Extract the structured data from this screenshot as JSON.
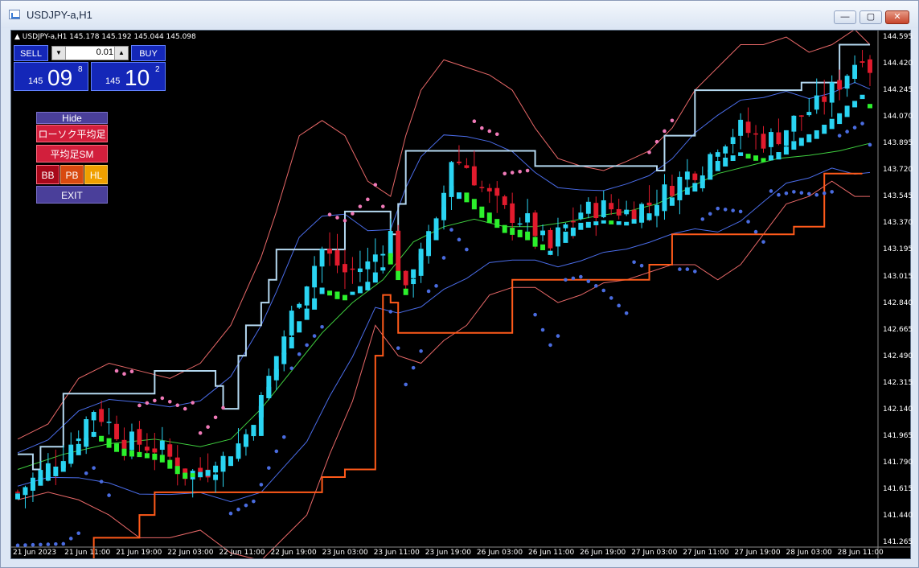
{
  "window": {
    "title": "USDJPY-a,H1",
    "minimize_label": "—",
    "maximize_label": "▢",
    "close_label": "✕"
  },
  "header": {
    "symbol_line": "▲ USDJPY-a,H1  145.178 145.192 145.044 145.098"
  },
  "trade_panel": {
    "sell_label": "SELL",
    "buy_label": "BUY",
    "lot_value": "0.01",
    "lot_down": "▼",
    "lot_up": "▲",
    "sell_prefix": "145",
    "sell_big": "09",
    "sell_sup": "8",
    "buy_prefix": "145",
    "buy_big": "10",
    "buy_sup": "2"
  },
  "indicator_panel": {
    "hide_label": "Hide",
    "btn1_label": "ローソク平均足2",
    "btn2_label": "平均足SM",
    "bb_label": "BB",
    "pb_label": "PB",
    "hl_label": "HL",
    "exit_label": "EXIT"
  },
  "colors": {
    "bull": "#2ad4f2",
    "bear": "#e11b2d",
    "green": "#2cf02c",
    "bb_outer": "#e86868",
    "bb_inner": "#4a6ce8",
    "ma": "#3fcf3f",
    "channel_top": "#b4d8f0",
    "channel_bottom": "#ff5a1a",
    "psar_up": "#4a6ce0",
    "psar_down": "#f07ab8"
  },
  "chart_data": {
    "type": "candlestick",
    "symbol": "USDJPY-a",
    "timeframe": "H1",
    "ohlc_header": {
      "open": 145.178,
      "high": 145.192,
      "low": 145.044,
      "close": 145.098
    },
    "y_ticks": [
      "144.595",
      "144.420",
      "144.245",
      "144.070",
      "143.895",
      "143.720",
      "143.545",
      "143.370",
      "143.195",
      "143.015",
      "142.840",
      "142.665",
      "142.490",
      "142.315",
      "142.140",
      "141.965",
      "141.790",
      "141.615",
      "141.440",
      "141.265"
    ],
    "x_ticks": [
      "21 Jun 2023",
      "21 Jun 11:00",
      "21 Jun 19:00",
      "22 Jun 03:00",
      "22 Jun 11:00",
      "22 Jun 19:00",
      "23 Jun 03:00",
      "23 Jun 11:00",
      "23 Jun 19:00",
      "26 Jun 03:00",
      "26 Jun 11:00",
      "26 Jun 19:00",
      "27 Jun 03:00",
      "27 Jun 11:00",
      "27 Jun 19:00",
      "28 Jun 03:00",
      "28 Jun 11:00"
    ],
    "ylim": [
      141.2,
      144.7
    ],
    "close_path": [
      [
        0,
        141.6
      ],
      [
        6,
        141.85
      ],
      [
        10,
        142.15
      ],
      [
        14,
        141.95
      ],
      [
        19,
        141.88
      ],
      [
        22,
        141.72
      ],
      [
        25,
        141.75
      ],
      [
        28,
        141.85
      ],
      [
        31,
        142.05
      ],
      [
        34,
        142.5
      ],
      [
        37,
        142.9
      ],
      [
        40,
        143.2
      ],
      [
        43,
        143.05
      ],
      [
        46,
        143.1
      ],
      [
        49,
        143.3
      ],
      [
        51,
        142.9
      ],
      [
        53,
        143.2
      ],
      [
        55,
        143.35
      ],
      [
        57,
        143.8
      ],
      [
        59,
        143.75
      ],
      [
        61,
        143.6
      ],
      [
        64,
        143.45
      ],
      [
        67,
        143.38
      ],
      [
        70,
        143.2
      ],
      [
        71,
        143.3
      ],
      [
        74,
        143.45
      ],
      [
        77,
        143.48
      ],
      [
        80,
        143.45
      ],
      [
        83,
        143.5
      ],
      [
        86,
        143.62
      ],
      [
        88,
        143.7
      ],
      [
        90,
        143.75
      ],
      [
        92,
        143.9
      ],
      [
        95,
        144.0
      ],
      [
        98,
        143.92
      ],
      [
        100,
        143.95
      ],
      [
        102,
        144.05
      ],
      [
        105,
        144.15
      ],
      [
        108,
        144.3
      ],
      [
        111,
        144.5
      ],
      [
        113,
        144.3
      ]
    ],
    "channel_top": [
      [
        0,
        141.85
      ],
      [
        2,
        141.75
      ],
      [
        3,
        141.9
      ],
      [
        6,
        141.9
      ],
      [
        6,
        142.25
      ],
      [
        14,
        142.25
      ],
      [
        18,
        142.4
      ],
      [
        25,
        142.4
      ],
      [
        26,
        142.3
      ],
      [
        27,
        142.15
      ],
      [
        28,
        142.15
      ],
      [
        29,
        142.5
      ],
      [
        30,
        142.7
      ],
      [
        31,
        142.7
      ],
      [
        32,
        142.85
      ],
      [
        33,
        143.0
      ],
      [
        34,
        143.2
      ],
      [
        42,
        143.2
      ],
      [
        43,
        143.45
      ],
      [
        48,
        143.45
      ],
      [
        49,
        143.3
      ],
      [
        50,
        143.5
      ],
      [
        51,
        143.85
      ],
      [
        64,
        143.85
      ],
      [
        68,
        143.75
      ],
      [
        70,
        143.75
      ],
      [
        83,
        143.75
      ],
      [
        84,
        143.72
      ],
      [
        85,
        143.95
      ],
      [
        88,
        143.95
      ],
      [
        89,
        144.25
      ],
      [
        103,
        144.25
      ],
      [
        103,
        144.3
      ],
      [
        107,
        144.3
      ],
      [
        108,
        144.55
      ],
      [
        112,
        144.55
      ]
    ],
    "channel_bottom": [
      [
        0,
        141.1
      ],
      [
        10,
        141.1
      ],
      [
        10,
        141.3
      ],
      [
        15,
        141.3
      ],
      [
        16,
        141.45
      ],
      [
        18,
        141.6
      ],
      [
        36,
        141.6
      ],
      [
        40,
        141.7
      ],
      [
        43,
        141.75
      ],
      [
        45,
        141.75
      ],
      [
        47,
        142.5
      ],
      [
        48,
        142.9
      ],
      [
        49,
        142.85
      ],
      [
        50,
        142.65
      ],
      [
        63,
        142.65
      ],
      [
        65,
        143.0
      ],
      [
        80,
        143.0
      ],
      [
        83,
        143.1
      ],
      [
        86,
        143.3
      ],
      [
        89,
        143.3
      ],
      [
        90,
        143.3
      ],
      [
        102,
        143.35
      ],
      [
        105,
        143.35
      ],
      [
        106,
        143.7
      ],
      [
        111,
        143.7
      ]
    ],
    "bb_upper": [
      [
        0,
        141.95
      ],
      [
        4,
        142.05
      ],
      [
        8,
        142.35
      ],
      [
        12,
        142.45
      ],
      [
        16,
        142.4
      ],
      [
        20,
        142.35
      ],
      [
        24,
        142.45
      ],
      [
        28,
        142.7
      ],
      [
        32,
        143.15
      ],
      [
        34,
        143.45
      ],
      [
        37,
        143.95
      ],
      [
        40,
        144.05
      ],
      [
        43,
        143.95
      ],
      [
        46,
        143.65
      ],
      [
        49,
        143.55
      ],
      [
        51,
        143.95
      ],
      [
        53,
        144.25
      ],
      [
        56,
        144.45
      ],
      [
        59,
        144.4
      ],
      [
        62,
        144.35
      ],
      [
        65,
        144.25
      ],
      [
        68,
        144.0
      ],
      [
        71,
        143.8
      ],
      [
        74,
        143.75
      ],
      [
        77,
        143.72
      ],
      [
        80,
        143.78
      ],
      [
        83,
        143.85
      ],
      [
        86,
        144.0
      ],
      [
        89,
        144.25
      ],
      [
        92,
        144.4
      ],
      [
        95,
        144.55
      ],
      [
        98,
        144.55
      ],
      [
        101,
        144.6
      ],
      [
        104,
        144.5
      ],
      [
        107,
        144.55
      ],
      [
        110,
        144.65
      ],
      [
        112,
        144.55
      ]
    ],
    "bb_lower": [
      [
        0,
        141.55
      ],
      [
        4,
        141.6
      ],
      [
        8,
        141.55
      ],
      [
        12,
        141.45
      ],
      [
        16,
        141.3
      ],
      [
        20,
        141.3
      ],
      [
        24,
        141.35
      ],
      [
        28,
        141.2
      ],
      [
        32,
        141.15
      ],
      [
        35,
        141.3
      ],
      [
        38,
        141.45
      ],
      [
        41,
        141.85
      ],
      [
        44,
        142.2
      ],
      [
        47,
        142.7
      ],
      [
        50,
        142.5
      ],
      [
        53,
        142.45
      ],
      [
        56,
        142.6
      ],
      [
        59,
        142.7
      ],
      [
        62,
        142.9
      ],
      [
        65,
        142.95
      ],
      [
        68,
        142.95
      ],
      [
        71,
        142.85
      ],
      [
        74,
        142.9
      ],
      [
        77,
        142.98
      ],
      [
        80,
        143.0
      ],
      [
        83,
        143.05
      ],
      [
        86,
        143.1
      ],
      [
        89,
        143.1
      ],
      [
        92,
        143.0
      ],
      [
        95,
        143.1
      ],
      [
        98,
        143.3
      ],
      [
        101,
        143.5
      ],
      [
        104,
        143.55
      ],
      [
        107,
        143.65
      ],
      [
        110,
        143.55
      ],
      [
        112,
        143.55
      ]
    ],
    "ma": [
      [
        0,
        141.75
      ],
      [
        6,
        141.85
      ],
      [
        12,
        141.92
      ],
      [
        18,
        141.95
      ],
      [
        24,
        141.9
      ],
      [
        28,
        141.95
      ],
      [
        32,
        142.15
      ],
      [
        36,
        142.4
      ],
      [
        40,
        142.65
      ],
      [
        44,
        142.85
      ],
      [
        48,
        143.0
      ],
      [
        52,
        143.25
      ],
      [
        56,
        143.35
      ],
      [
        60,
        143.4
      ],
      [
        64,
        143.35
      ],
      [
        68,
        143.35
      ],
      [
        72,
        143.38
      ],
      [
        76,
        143.42
      ],
      [
        80,
        143.45
      ],
      [
        84,
        143.5
      ],
      [
        88,
        143.6
      ],
      [
        92,
        143.7
      ],
      [
        96,
        143.75
      ],
      [
        100,
        143.8
      ],
      [
        104,
        143.82
      ],
      [
        108,
        143.85
      ],
      [
        112,
        143.9
      ]
    ]
  }
}
